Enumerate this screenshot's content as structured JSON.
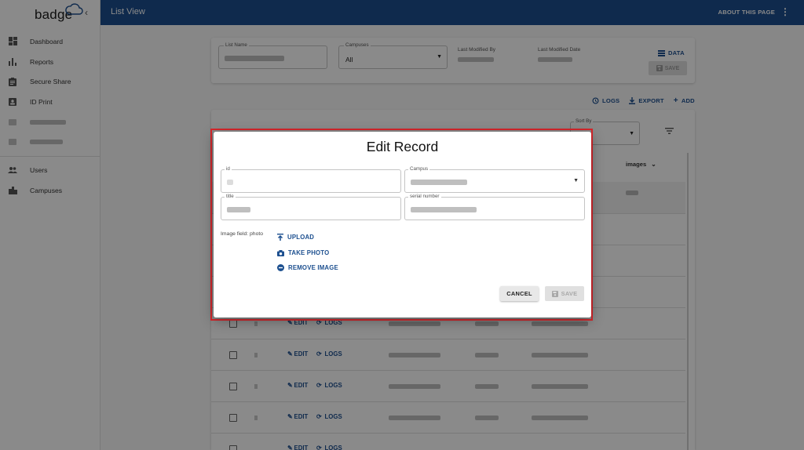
{
  "app": {
    "logo_text": "badge",
    "view_title": "List View",
    "about_label": "ABOUT THIS PAGE"
  },
  "sidebar": {
    "items": [
      {
        "label": "Dashboard",
        "icon": "dashboard-icon"
      },
      {
        "label": "Reports",
        "icon": "bar-chart-icon"
      },
      {
        "label": "Secure Share",
        "icon": "clipboard-icon"
      },
      {
        "label": "ID Print",
        "icon": "id-card-icon"
      }
    ],
    "admin_items": [
      {
        "label": "Users",
        "icon": "users-icon"
      },
      {
        "label": "Campuses",
        "icon": "building-icon"
      }
    ]
  },
  "filters": {
    "list_name_label": "List Name",
    "campuses_label": "Campuses",
    "campuses_value": "All",
    "last_modified_by_label": "Last Modified By",
    "last_modified_date_label": "Last Modified Date",
    "data_label": "DATA",
    "save_label": "SAVE"
  },
  "toolbar": {
    "logs_label": "LOGS",
    "export_label": "EXPORT",
    "add_label": "ADD"
  },
  "table": {
    "sort_by_label": "Sort By",
    "images_header": "images",
    "edit_label": "EDIT",
    "logs_label": "LOGS"
  },
  "dialog": {
    "title": "Edit Record",
    "id_label": "id",
    "campus_label": "Campus",
    "title_label": "title",
    "serial_label": "serial number",
    "image_field_label": "Image field: photo",
    "upload_label": "UPLOAD",
    "take_photo_label": "TAKE PHOTO",
    "remove_image_label": "REMOVE IMAGE",
    "cancel_label": "CANCEL",
    "save_label": "SAVE"
  },
  "colors": {
    "primary": "#1c4f8f",
    "highlight_outline": "#d9262b"
  }
}
